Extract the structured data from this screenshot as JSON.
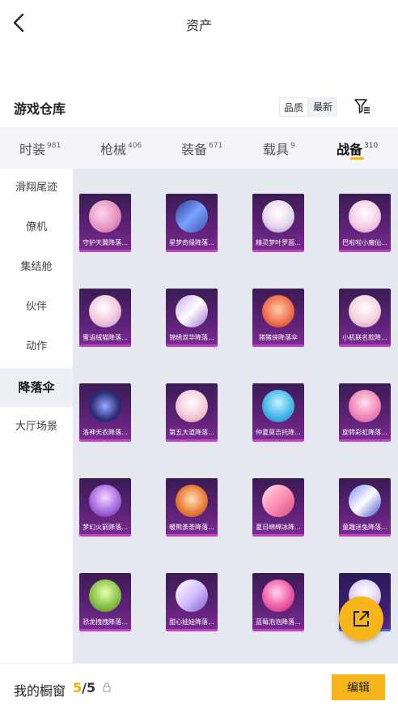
{
  "header": {
    "title": "资产"
  },
  "warehouse": {
    "title": "游戏仓库",
    "sort_options": [
      "品质",
      "最新"
    ]
  },
  "tabs": [
    {
      "label": "时装",
      "count": "981"
    },
    {
      "label": "枪械",
      "count": "406"
    },
    {
      "label": "装备",
      "count": "671"
    },
    {
      "label": "载具",
      "count": "9"
    },
    {
      "label": "战备",
      "count": "310"
    }
  ],
  "sidebar": [
    "滑翔尾迹",
    "僚机",
    "集结舱",
    "伙伴",
    "动作",
    "降落伞",
    "大厅场景"
  ],
  "items": [
    "守护天翼降落...",
    "星梦奇缘降落...",
    "精灵梦叶罗面...",
    "巴啦啦小魔仙...",
    "蜜语绒猫降落...",
    "锦绣双华降落...",
    "猪猪侠降落伞",
    "小机联名款降...",
    "洛神天衣降落...",
    "第五大道降落...",
    "仲夏莫吉托降...",
    "旋转彩虹降落...",
    "梦幻火箭降落...",
    "暖熊荼荼降落...",
    "夏日绵绵冰降...",
    "童趣迷兔降落...",
    "恐龙拽拽降落...",
    "甜心娃娃降落...",
    "蓝莓泡泡降落...",
    ""
  ],
  "bottom": {
    "label": "我的橱窗",
    "count_current": "5",
    "count_sep": "/",
    "count_max": "5",
    "edit_label": "编辑"
  },
  "colors": {
    "accent": "#f7b51c",
    "card_bg": "#5c2276",
    "card_border": "#c040c8"
  }
}
